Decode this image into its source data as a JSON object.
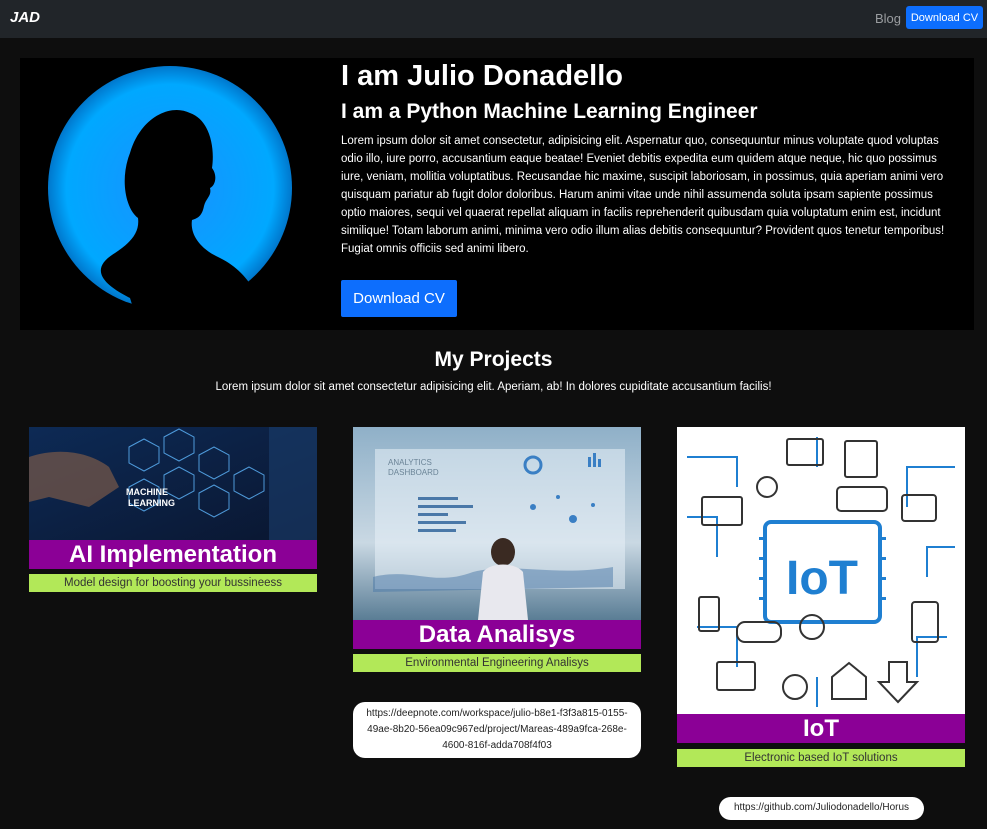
{
  "nav": {
    "brand": "JAD",
    "blog": "Blog",
    "download": "Download CV"
  },
  "hero": {
    "title": "I am Julio Donadello",
    "subtitle": "I am a Python Machine Learning Engineer",
    "text": "Lorem ipsum dolor sit amet consectetur, adipisicing elit. Aspernatur quo, consequuntur minus voluptate quod voluptas odio illo, iure porro, accusantium eaque beatae! Eveniet debitis expedita eum quidem atque neque, hic quo possimus iure, veniam, mollitia voluptatibus. Recusandae hic maxime, suscipit laboriosam, in possimus, quia aperiam animi vero quisquam pariatur ab fugit dolor doloribus. Harum animi vitae unde nihil assumenda soluta ipsam sapiente possimus optio maiores, sequi vel quaerat repellat aliquam in facilis reprehenderit quibusdam quia voluptatum enim est, incidunt similique! Totam laborum animi, minima vero odio illum alias debitis consequuntur? Provident quos tenetur temporibus! Fugiat omnis officiis sed animi libero.",
    "button": "Download CV"
  },
  "projects": {
    "title": "My Projects",
    "subtitle": "Lorem ipsum dolor sit amet consectetur adipisicing elit. Aperiam, ab! In dolores cupiditate accusantium facilis!",
    "cards": [
      {
        "title": "AI Implementation",
        "desc": "Model design for boosting your bussineess",
        "image_text_1": "MACHINE",
        "image_text_2": "LEARNING"
      },
      {
        "title": "Data Analisys",
        "desc": "Environmental Engineering Analisys",
        "image_text_1": "ANALYTICS",
        "image_text_2": "DASHBOARD",
        "url": "https://deepnote.com/workspace/julio-b8e1-f3f3a815-0155-49ae-8b20-56ea09c967ed/project/Mareas-489a9fca-268e-4600-816f-adda708f4f03"
      },
      {
        "title": "IoT",
        "desc": "Electronic based IoT solutions",
        "image_text_1": "IoT",
        "url": "https://github.com/Juliodonadello/Horus"
      }
    ]
  },
  "colors": {
    "navbar": "#212529",
    "primary": "#0d6efd",
    "card_title_bg": "#8b0096",
    "card_desc_bg": "#b2e858",
    "hero_glow": "#00a8ff"
  }
}
